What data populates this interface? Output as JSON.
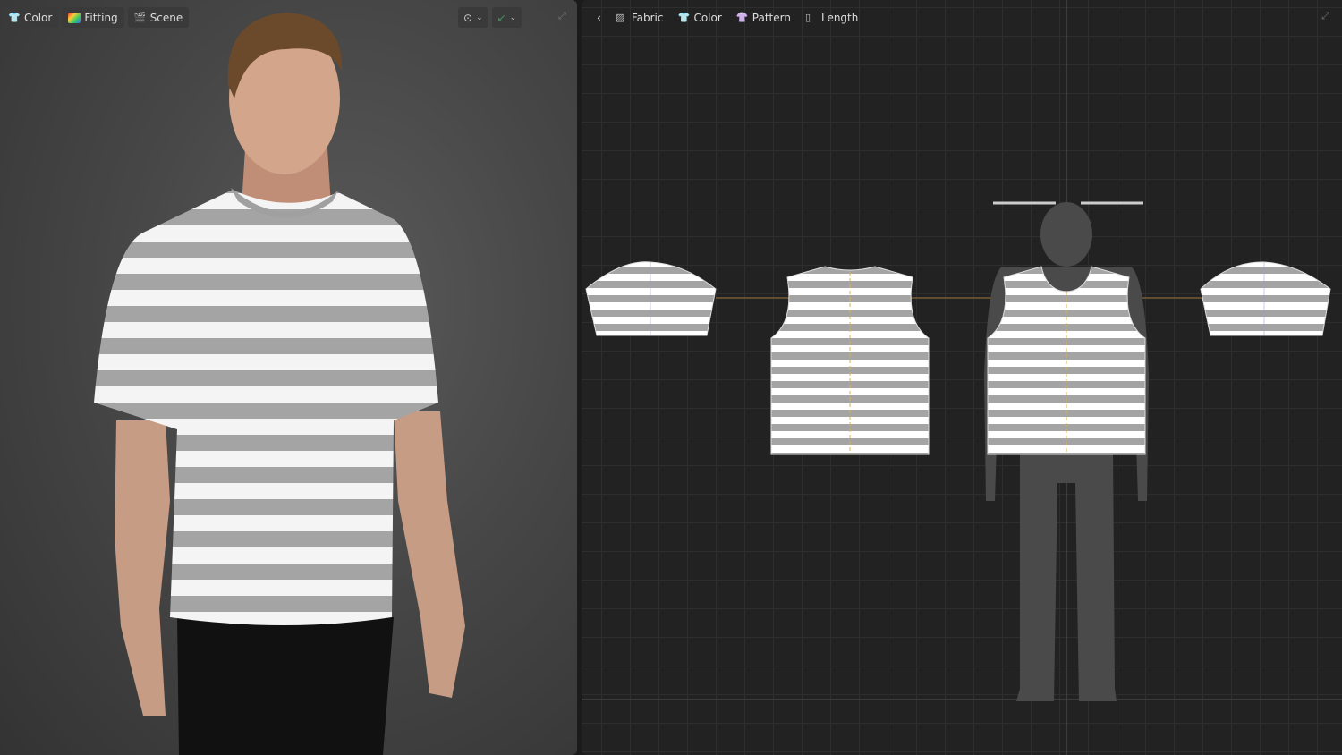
{
  "left_toolbar": {
    "items": [
      {
        "label": "Color",
        "icon": "color-icon"
      },
      {
        "label": "Fitting",
        "icon": "fitting-icon"
      },
      {
        "label": "Scene",
        "icon": "scene-icon"
      }
    ]
  },
  "view_controls": {
    "play_icon": "play-circle-icon",
    "arrow_icon": "arrow-tool-icon",
    "expand_icon": "expand-icon"
  },
  "right_toolbar": {
    "back_icon": "chevron-left-icon",
    "items": [
      {
        "label": "Fabric",
        "icon": "fabric-icon"
      },
      {
        "label": "Color",
        "icon": "color-icon"
      },
      {
        "label": "Pattern",
        "icon": "pattern-icon"
      },
      {
        "label": "Length",
        "icon": "length-icon"
      }
    ]
  },
  "colors": {
    "stripe_gray": "#a4a4a4",
    "stripe_white": "#ffffff",
    "accent_line": "#c8963c",
    "seam_yellow": "#e0b04a"
  }
}
